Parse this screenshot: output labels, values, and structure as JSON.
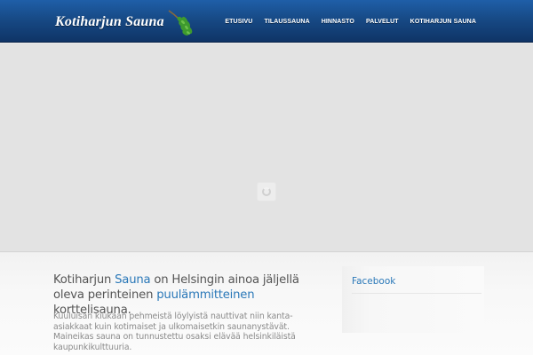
{
  "header": {
    "logo_text": "Kotiharjun Sauna",
    "logo_icon": "vihta-icon",
    "nav": [
      {
        "label": "ETUSIVU"
      },
      {
        "label": "TILAUSSAUNA"
      },
      {
        "label": "HINNASTO"
      },
      {
        "label": "PALVELUT"
      },
      {
        "label": "KOTIHARJUN SAUNA"
      }
    ]
  },
  "slider": {
    "state_icon": "loading-spinner-icon"
  },
  "main": {
    "intro": {
      "part1": "Kotiharjun ",
      "highlight1": "Sauna",
      "part2": " on Helsingin ainoa jäljellä oleva perinteinen ",
      "highlight2": "puulämmitteinen",
      "part3": " korttelisauna."
    },
    "paragraph": "Kuuluisan kiukaan pehmeistä löylyistä nauttivat niin kanta-asiakkaat kuin kotimaiset ja ulkomaisetkin saunanystävät. Maineikas sauna on tunnustettu osaksi elävää helsinkiläistä kaupunkikulttuuria."
  },
  "sidebar": {
    "title": "Facebook"
  },
  "colors": {
    "header_top": "#1f5fa8",
    "header_bottom": "#0f3466",
    "accent": "#2a78b8",
    "body_text": "#8a8a8a"
  }
}
